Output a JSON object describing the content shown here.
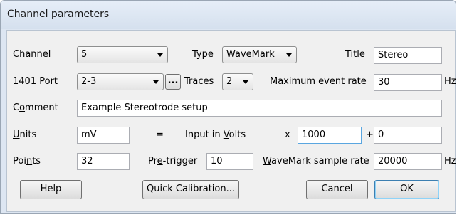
{
  "window": {
    "title": "Channel parameters"
  },
  "labels": {
    "channel_pre": "",
    "channel_u": "C",
    "channel_post": "hannel",
    "type_pre": "Ty",
    "type_u": "p",
    "type_post": "e",
    "title_pre": "",
    "title_u": "T",
    "title_post": "itle",
    "port_pre": "1401 ",
    "port_u": "P",
    "port_post": "ort",
    "traces_pre": "Tr",
    "traces_u": "a",
    "traces_post": "ces",
    "maxrate_pre": "Maximum event ",
    "maxrate_u": "r",
    "maxrate_post": "ate",
    "comment_pre": "C",
    "comment_u": "o",
    "comment_post": "mment",
    "units_pre": "",
    "units_u": "U",
    "units_post": "nits",
    "equals": "=",
    "input_pre": "Input in ",
    "input_u": "V",
    "input_post": "olts",
    "times": "x",
    "plus": "+",
    "points_pre": "Poi",
    "points_u": "n",
    "points_post": "ts",
    "pretrigger_pre": "Pr",
    "pretrigger_u": "e",
    "pretrigger_post": "-trigger",
    "samplerate_pre": "",
    "samplerate_u": "W",
    "samplerate_post": "aveMark sample rate",
    "hz1": "Hz",
    "hz2": "Hz"
  },
  "fields": {
    "channel": "5",
    "type": "WaveMark",
    "title": "Stereo",
    "port": "2-3",
    "port_browse": "...",
    "traces": "2",
    "max_event_rate": "30",
    "comment": "Example Stereotrode setup",
    "units": "mV",
    "scale": "1000",
    "offset": "0",
    "points": "32",
    "pretrigger": "10",
    "sample_rate": "20000"
  },
  "buttons": {
    "help": "Help",
    "quick_calibration": "Quick Calibration...",
    "cancel": "Cancel",
    "ok": "OK"
  }
}
